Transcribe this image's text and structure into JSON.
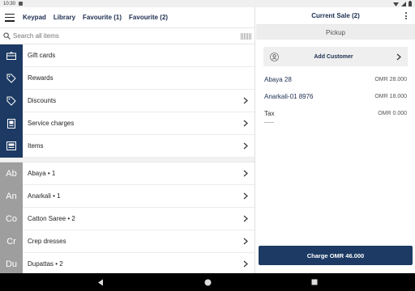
{
  "status_bar": {
    "time": "10:30"
  },
  "header": {
    "tabs": [
      {
        "label": "Keypad"
      },
      {
        "label": "Library"
      },
      {
        "label": "Favourite (1)"
      },
      {
        "label": "Favourite (2)"
      }
    ]
  },
  "search": {
    "placeholder": "Search all items"
  },
  "categories": [
    {
      "label": "Gift cards",
      "icon": "gift-card-icon"
    },
    {
      "label": "Rewards",
      "icon": "tag-icon"
    },
    {
      "label": "Discounts",
      "icon": "tag-icon"
    },
    {
      "label": "Service charges",
      "icon": "receipt-icon"
    },
    {
      "label": "Items",
      "icon": "items-icon"
    }
  ],
  "item_groups": [
    {
      "abbr": "Ab",
      "label": "Abaya • 1"
    },
    {
      "abbr": "An",
      "label": "Anarkali • 1"
    },
    {
      "abbr": "Co",
      "label": "Catton Saree • 2"
    },
    {
      "abbr": "Cr",
      "label": "Crep dresses"
    },
    {
      "abbr": "Du",
      "label": "Dupattas • 2"
    }
  ],
  "sale": {
    "title": "Current Sale (2)",
    "pickup_label": "Pickup",
    "add_customer_label": "Add Customer",
    "lines": [
      {
        "name": "Abaya 28",
        "price": "OMR 28.000"
      },
      {
        "name": "Anarkali-01 8976",
        "price": "OMR 18.000"
      }
    ],
    "tax": {
      "name": "Tax",
      "price": "OMR 0.000"
    },
    "charge_label": "Charge OMR 46.000"
  },
  "colors": {
    "brand": "#1c3a63",
    "group_tile": "#9e9e9e"
  }
}
